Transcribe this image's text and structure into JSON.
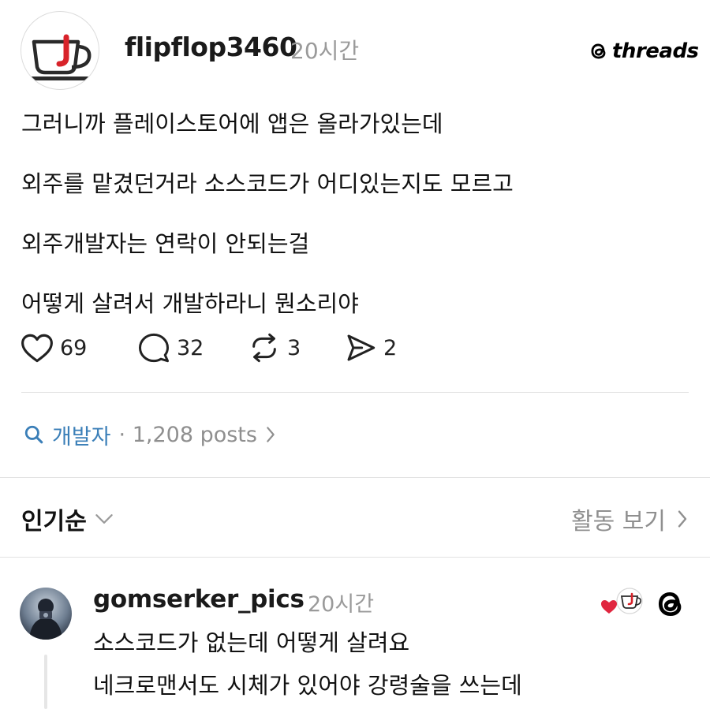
{
  "post": {
    "username": "flipflop3460",
    "time": "20시간",
    "brand": "threads",
    "lines": [
      "그러니까 플레이스토어에 앱은 올라가있는데",
      "외주를 맡겼던거라 소스코드가 어디있는지도 모르고",
      "외주개발자는 연락이 안되는걸",
      "어떻게 살려서 개발하라니 뭔소리야"
    ],
    "actions": {
      "likes": "69",
      "comments": "32",
      "reposts": "3",
      "shares": "2"
    }
  },
  "topic": {
    "name": "개발자",
    "count": "· 1,208 posts"
  },
  "sort": {
    "label": "인기순",
    "activity": "활동 보기"
  },
  "reply": {
    "username": "gomserker_pics",
    "time": "20시간",
    "lines": [
      "소스코드가 없는데 어떻게 살려요",
      "네크로맨서도 시체가 있어야 강령술을 쓰는데"
    ]
  },
  "colors": {
    "accent_blue": "#3b7fb8",
    "like_red": "#e0263f",
    "muted": "#8f8f8f"
  },
  "icons": [
    "cup-logo-icon",
    "threads-logo-icon",
    "heart-icon",
    "comment-icon",
    "repost-icon",
    "share-icon",
    "search-icon",
    "chevron-right-icon",
    "chevron-down-icon"
  ]
}
